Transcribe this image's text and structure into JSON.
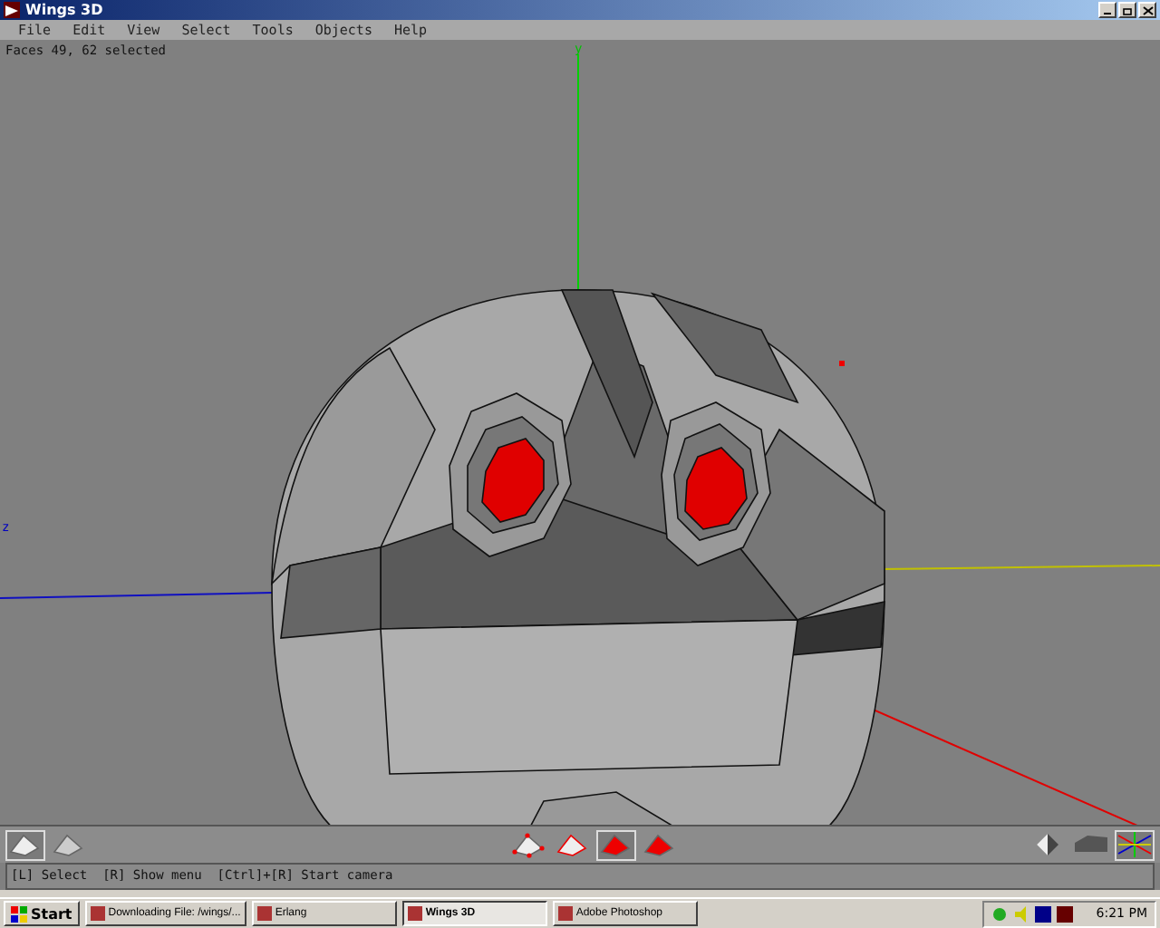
{
  "window": {
    "title": "Wings 3D"
  },
  "menu": [
    "File",
    "Edit",
    "View",
    "Select",
    "Tools",
    "Objects",
    "Help"
  ],
  "viewport": {
    "info": "Faces 49, 62 selected",
    "axis_labels": [
      {
        "kind": "y",
        "text": "y"
      },
      {
        "kind": "z",
        "text": "z"
      }
    ]
  },
  "toolbar": {
    "view_buttons": [
      {
        "kind": "flat",
        "selected": true
      },
      {
        "kind": "smooth",
        "selected": false
      }
    ],
    "select_modes": [
      {
        "kind": "vertex",
        "selected": false
      },
      {
        "kind": "edge",
        "selected": false
      },
      {
        "kind": "face",
        "selected": true
      },
      {
        "kind": "body",
        "selected": false
      }
    ],
    "display_buttons": [
      {
        "kind": "perspective",
        "selected": false
      },
      {
        "kind": "groundplane",
        "selected": false
      },
      {
        "kind": "axes",
        "selected": true
      }
    ]
  },
  "status_bar": "[L] Select  [R] Show menu  [Ctrl]+[R] Start camera",
  "taskbar": {
    "start": "Start",
    "tasks": [
      {
        "label": "Downloading File: /wings/...",
        "selected": false
      },
      {
        "label": "Erlang",
        "selected": false
      },
      {
        "label": "Wings 3D",
        "selected": true
      },
      {
        "label": "Adobe Photoshop",
        "selected": false
      }
    ],
    "clock": "6:21 PM"
  }
}
